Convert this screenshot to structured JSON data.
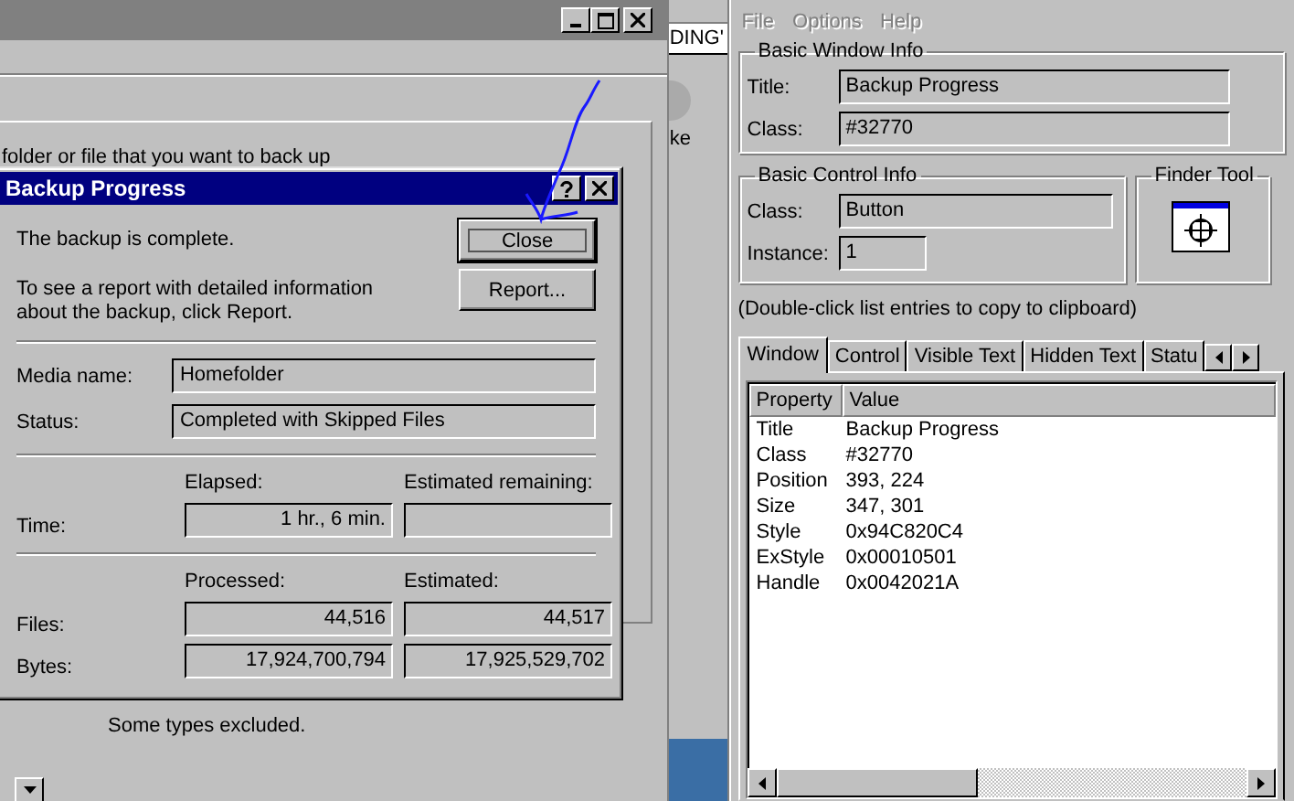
{
  "background_window": {
    "text": "folder or file that you want to back up",
    "note": "Some types excluded."
  },
  "strip": {
    "texts": [
      "DING'",
      "ke"
    ]
  },
  "dialog": {
    "title": "Backup Progress",
    "message": "The backup is complete.",
    "report_hint": "To see a report with detailed information about the backup, click Report.",
    "buttons": [
      {
        "label": "Close",
        "focused": true
      },
      {
        "label": "Report...",
        "focused": false
      }
    ],
    "fields": [
      {
        "label": "Media name:",
        "value": "Homefolder"
      },
      {
        "label": "Status:",
        "value": "Completed with Skipped Files"
      }
    ],
    "time": {
      "label": "Time:",
      "columns": [
        "Elapsed:",
        "Estimated remaining:"
      ],
      "elapsed": "1 hr., 6 min."
    },
    "counts": {
      "columns": [
        "Processed:",
        "Estimated:"
      ],
      "rows": [
        {
          "label": "Files:",
          "values": [
            "44,516",
            "44,517"
          ]
        },
        {
          "label": "Bytes:",
          "values": [
            "17,924,700,794",
            "17,925,529,702"
          ]
        }
      ]
    }
  },
  "info_window": {
    "menu": [
      {
        "label": "File",
        "disabled": true
      },
      {
        "label": "Options",
        "disabled": true
      },
      {
        "label": "Help",
        "disabled": true
      }
    ],
    "basic_window_info": {
      "title": "Basic Window Info",
      "fields": [
        {
          "label": "Title:",
          "value": "Backup Progress"
        },
        {
          "label": "Class:",
          "value": "#32770"
        }
      ]
    },
    "basic_control_info": {
      "title": "Basic Control Info",
      "fields": [
        {
          "label": "Class:",
          "value": "Button"
        },
        {
          "label": "Instance:",
          "value": "1"
        }
      ]
    },
    "finder_tool": {
      "title": "Finder Tool"
    },
    "hint": "(Double-click list entries to copy to clipboard)",
    "tabs": [
      {
        "label": "Window",
        "selected": true
      },
      {
        "label": "Control",
        "selected": false
      },
      {
        "label": "Visible Text",
        "selected": false
      },
      {
        "label": "Hidden Text",
        "selected": false
      },
      {
        "label": "Statu",
        "selected": false
      }
    ],
    "table": {
      "columns": [
        "Property",
        "Value"
      ],
      "rows": [
        [
          "Title",
          "Backup Progress"
        ],
        [
          "Class",
          "#32770"
        ],
        [
          "Position",
          "393, 224"
        ],
        [
          "Size",
          "347, 301"
        ],
        [
          "Style",
          "0x94C820C4"
        ],
        [
          "ExStyle",
          "0x00010501"
        ],
        [
          "Handle",
          "0x0042021A"
        ]
      ]
    }
  }
}
